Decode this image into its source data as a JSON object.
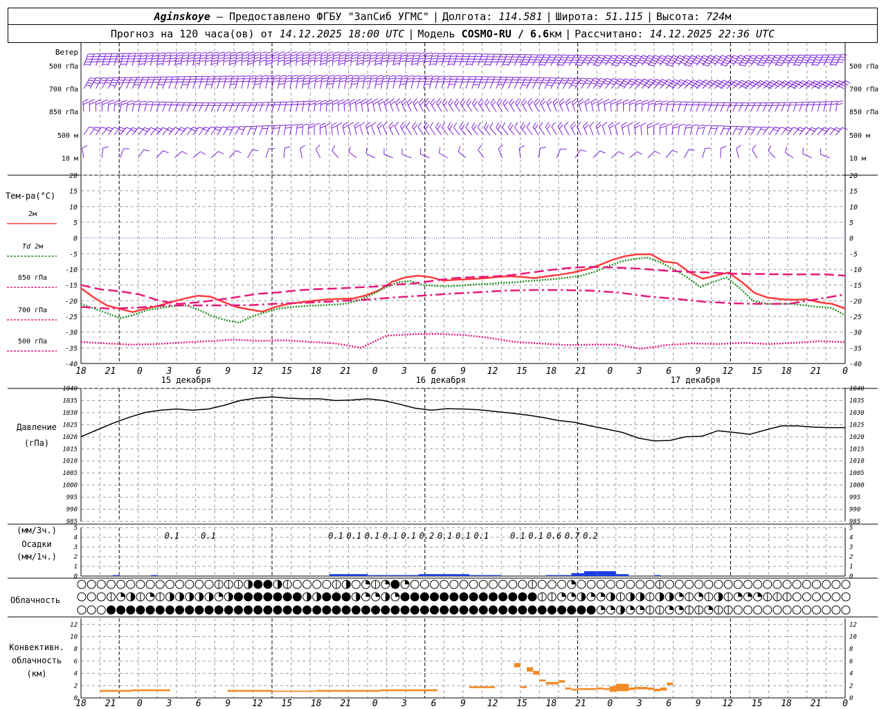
{
  "header": {
    "station": "Aginskoye",
    "provider": "– Предоставлено ФГБУ \"ЗапСиб УГМС\"",
    "lon_label": "Долгота:",
    "lon": "114.581",
    "lat_label": "Широта:",
    "lat": "51.115",
    "alt_label": "Высота:",
    "alt": "724",
    "alt_unit": "м",
    "forecast_label": "Прогноз на 120 часа(ов) от",
    "forecast_start": "14.12.2025 18:00 UTC",
    "model_label": "Модель",
    "model": "COSMO-RU / 6.6",
    "model_unit": "км",
    "calc_label": "Рассчитано:",
    "calc_time": "14.12.2025 22:36 UTC"
  },
  "chart_data": [
    {
      "type": "wind-barbs",
      "title": "Ветер",
      "levels": [
        "500 гПа",
        "700 гПа",
        "850 гПа",
        "500 м",
        "10 м"
      ],
      "colors": {
        "barb": "#7B1FD6"
      }
    },
    {
      "type": "line",
      "title": "Тем-ра(°C)",
      "ylim": [
        -40,
        20
      ],
      "yticks": [
        20,
        15,
        10,
        5,
        0,
        -5,
        -10,
        -15,
        -20,
        -25,
        -30,
        -35,
        -40
      ],
      "x_hours": [
        0,
        3,
        6,
        9,
        12,
        15,
        18,
        21,
        24,
        27,
        30,
        33,
        36,
        39,
        42,
        45,
        48,
        51,
        54,
        57,
        60,
        63,
        66,
        69,
        72,
        75,
        78,
        81,
        84,
        87,
        90,
        93,
        96,
        99,
        102,
        105,
        108,
        111,
        114,
        117,
        120,
        123,
        126,
        129,
        132,
        135,
        138,
        141,
        144,
        147,
        150,
        153,
        156,
        159,
        162,
        165,
        168,
        171,
        174,
        177,
        180,
        183,
        186,
        189,
        192,
        195,
        198,
        201,
        204,
        207,
        210,
        213,
        216,
        219,
        222,
        225,
        228,
        231,
        234,
        237,
        240,
        243,
        246,
        249,
        252,
        255,
        258,
        261,
        264,
        267,
        270,
        273,
        276,
        279,
        282,
        285,
        288,
        291,
        294,
        297,
        300,
        303,
        306,
        309,
        312,
        315,
        318,
        321,
        324,
        327,
        330,
        333,
        336,
        339,
        342,
        345,
        348,
        351,
        354,
        357,
        360,
        363,
        366,
        369,
        372,
        375,
        378
      ],
      "series": [
        {
          "name": "2м",
          "color": "#FF3B3B",
          "style": "solid",
          "values": [
            -16,
            -19,
            -21.5,
            -22.6,
            -23.6,
            -22.5,
            -21.6,
            -20.4,
            -19.3,
            -18.4,
            -18.7,
            -20.4,
            -22,
            -22.8,
            -23.5,
            -22,
            -21,
            -20.5,
            -20,
            -19.6,
            -19.4,
            -19.3,
            -18.3,
            -16.7,
            -14,
            -12.6,
            -12,
            -12.5,
            -13.6,
            -13.3,
            -13.1,
            -12.9,
            -12.5,
            -12.2,
            -12.4,
            -12.8,
            -12.2,
            -11.7,
            -11,
            -10,
            -8.7,
            -7,
            -5.8,
            -5.2,
            -5.2,
            -7.5,
            -8,
            -11,
            -13,
            -12,
            -11,
            -14,
            -17.5,
            -19,
            -19.5,
            -19.7,
            -19.5,
            -20.5,
            -21,
            -22.5
          ]
        },
        {
          "name": "Td 2м",
          "color": "#1E8C1E",
          "style": "dotted",
          "values": [
            -21,
            -22.5,
            -24,
            -25.6,
            -24.5,
            -23,
            -22.3,
            -21.7,
            -21.5,
            -23,
            -25,
            -26.2,
            -27,
            -25,
            -23.7,
            -22.5,
            -22,
            -21.7,
            -21.5,
            -21.3,
            -21,
            -20,
            -18.2,
            -16,
            -14.2,
            -13.7,
            -15,
            -15.3,
            -15.4,
            -15.1,
            -14.8,
            -14.6,
            -14.3,
            -14.1,
            -13.7,
            -13.4,
            -13.1,
            -12.6,
            -12,
            -10.8,
            -9,
            -7.5,
            -6.7,
            -6.3,
            -7.8,
            -10,
            -12.5,
            -15.6,
            -14,
            -12.6,
            -16,
            -20,
            -21,
            -21,
            -21,
            -21.5,
            -22,
            -22.3,
            -24.7
          ]
        },
        {
          "name": "850 гПа",
          "color": "#E6197D",
          "style": "longdash",
          "values": [
            -15,
            -16.4,
            -17,
            -18,
            -20,
            -21,
            -20.5,
            -19.7,
            -18.8,
            -17.8,
            -17.4,
            -16.7,
            -16.3,
            -16.1,
            -15.8,
            -15.5,
            -14.9,
            -14.5,
            -13.6,
            -12.8,
            -12.5,
            -12.3,
            -11.8,
            -11,
            -10.2,
            -9.5,
            -9.2,
            -9.4,
            -9.6,
            -10,
            -10.5,
            -10.8,
            -11,
            -11.3,
            -11.5,
            -11.5,
            -11.6,
            -11.6,
            -11.6,
            -12
          ]
        },
        {
          "name": "700 гПа",
          "color": "#E6197D",
          "style": "dashdot",
          "values": [
            -22,
            -22.5,
            -22.2,
            -21.5,
            -21.5,
            -21.5,
            -21.4,
            -20.9,
            -20.6,
            -20.2,
            -19.7,
            -19,
            -18.4,
            -17.8,
            -17.3,
            -16.8,
            -16.6,
            -16.6,
            -16.8,
            -17.4,
            -18.6,
            -19.4,
            -20.3,
            -20.8,
            -21,
            -21,
            -19.5,
            -18
          ]
        },
        {
          "name": "500 гПа",
          "color": "#E6197D",
          "style": "dotted",
          "values": [
            -33.1,
            -33.6,
            -34,
            -33.8,
            -33.3,
            -32.9,
            -32.4,
            -32.8,
            -32.6,
            -33.1,
            -33.6,
            -35,
            -31.1,
            -30.7,
            -30.6,
            -30.9,
            -31.8,
            -33.1,
            -33.6,
            -34.1,
            -34,
            -34,
            -35.3,
            -34.1,
            -33.6,
            -33.8,
            -33.4,
            -33.8,
            -33.4,
            -32.9,
            -33.2
          ]
        }
      ]
    },
    {
      "type": "line",
      "title": "Давление",
      "ylabel": "(гПа)",
      "ylim": [
        985,
        1040
      ],
      "yticks": [
        1040,
        1035,
        1030,
        1025,
        1020,
        1015,
        1010,
        1005,
        1000,
        995,
        990,
        985
      ],
      "series": [
        {
          "name": "Давление",
          "color": "#000000",
          "values": [
            1020,
            1022.8,
            1025.6,
            1028,
            1030,
            1031,
            1031.5,
            1031,
            1031.5,
            1033,
            1035,
            1036,
            1036.5,
            1036,
            1035.7,
            1035.7,
            1035,
            1035.2,
            1035.7,
            1035,
            1033.5,
            1031.8,
            1031,
            1031.6,
            1031.5,
            1031.2,
            1030.5,
            1029.8,
            1029,
            1028,
            1026.7,
            1026,
            1024.5,
            1023.2,
            1021.8,
            1019.5,
            1018.3,
            1018.5,
            1020,
            1020.2,
            1022.5,
            1021.8,
            1021,
            1022.8,
            1024.5,
            1024.5,
            1024,
            1023.8,
            1023.8
          ]
        }
      ]
    },
    {
      "type": "bar",
      "title": "Осадки",
      "ylabel_top": "(мм/3ч.)",
      "ylabel_bottom": "(мм/1ч.)",
      "ylim": [
        0,
        5
      ],
      "yticks": [
        5,
        4,
        3,
        2,
        1,
        0
      ],
      "totals_3h": [
        {
          "hour": 15,
          "value": "0.1"
        },
        {
          "hour": 21,
          "value": "0.1"
        },
        {
          "hour": 42,
          "value": "0.1"
        },
        {
          "hour": 45,
          "value": "0.1"
        },
        {
          "hour": 48,
          "value": "0.1"
        },
        {
          "hour": 51,
          "value": "0.1"
        },
        {
          "hour": 54,
          "value": "0.1"
        },
        {
          "hour": 57,
          "value": "0.2"
        },
        {
          "hour": 60,
          "value": "0.1"
        },
        {
          "hour": 63,
          "value": "0.1"
        },
        {
          "hour": 66,
          "value": "0.1"
        },
        {
          "hour": 72,
          "value": "0.1"
        },
        {
          "hour": 75,
          "value": "0.1"
        },
        {
          "hour": 78,
          "value": "0.6"
        },
        {
          "hour": 81,
          "value": "0.7"
        },
        {
          "hour": 84,
          "value": "0.2"
        }
      ],
      "hourly": [
        {
          "h0": 5,
          "h1": 6,
          "value": 0.1
        },
        {
          "h0": 11,
          "h1": 12,
          "value": 0.1
        },
        {
          "h0": 39,
          "h1": 45,
          "value": 0.2
        },
        {
          "h0": 45,
          "h1": 53,
          "value": 0.1
        },
        {
          "h0": 53,
          "h1": 56,
          "value": 0.2
        },
        {
          "h0": 56,
          "h1": 61,
          "value": 0.2
        },
        {
          "h0": 61,
          "h1": 66,
          "value": 0.1
        },
        {
          "h0": 73,
          "h1": 77,
          "value": 0.1
        },
        {
          "h0": 77,
          "h1": 79,
          "value": 0.3
        },
        {
          "h0": 79,
          "h1": 81,
          "value": 0.5
        },
        {
          "h0": 81,
          "h1": 84,
          "value": 0.5
        },
        {
          "h0": 84,
          "h1": 86,
          "value": 0.2
        },
        {
          "h0": 90,
          "h1": 91,
          "value": 0.1
        }
      ],
      "colors": {
        "bar": "#1A3FE0"
      }
    },
    {
      "type": "table",
      "title": "Облачность",
      "rows": [
        "0000000000000000000000001111112344413310000000211300121123432101000000000000000000011000001200000000000000001100000000000000000000000000000000000",
        "0000112233212312333333333233344444444444413334444443122231244444444444444444444444444310123233123223123332123332111211233121232311111000000000000",
        "0000044444444444444444444444444444444444444444444444444444444444444444444444444444444444444444442212312321111222211112111100000000000000000000000"
      ]
    },
    {
      "type": "bar",
      "title": "Конвективн.",
      "ylabel": [
        "облачность",
        "(км)"
      ],
      "ylim": [
        0,
        13
      ],
      "yticks": [
        12,
        10,
        8,
        6,
        4,
        2,
        0
      ],
      "segments": [
        {
          "h0": 3,
          "h1": 5,
          "bottom": 1.0,
          "top": 1.3
        },
        {
          "h0": 5,
          "h1": 8,
          "bottom": 1.0,
          "top": 1.3
        },
        {
          "h0": 8,
          "h1": 11,
          "bottom": 1.1,
          "top": 1.4
        },
        {
          "h0": 11,
          "h1": 14,
          "bottom": 1.1,
          "top": 1.4
        },
        {
          "h0": 23,
          "h1": 30,
          "bottom": 1.0,
          "top": 1.3
        },
        {
          "h0": 30,
          "h1": 37,
          "bottom": 1.0,
          "top": 1.2
        },
        {
          "h0": 37,
          "h1": 40,
          "bottom": 1.0,
          "top": 1.3
        },
        {
          "h0": 40,
          "h1": 47,
          "bottom": 1.0,
          "top": 1.3
        },
        {
          "h0": 47,
          "h1": 53,
          "bottom": 1.1,
          "top": 1.4
        },
        {
          "h0": 53,
          "h1": 56,
          "bottom": 1.1,
          "top": 1.4
        },
        {
          "h0": 61,
          "h1": 64,
          "bottom": 1.6,
          "top": 1.9
        },
        {
          "h0": 64,
          "h1": 65,
          "bottom": 1.6,
          "top": 1.9
        },
        {
          "h0": 68,
          "h1": 69,
          "bottom": 5.0,
          "top": 5.7
        },
        {
          "h0": 69,
          "h1": 70,
          "bottom": 1.6,
          "top": 1.9
        },
        {
          "h0": 70,
          "h1": 71,
          "bottom": 4.3,
          "top": 5.0
        },
        {
          "h0": 71,
          "h1": 72,
          "bottom": 3.8,
          "top": 4.4
        },
        {
          "h0": 72,
          "h1": 73,
          "bottom": 2.7,
          "top": 3.0
        },
        {
          "h0": 73,
          "h1": 75,
          "bottom": 2.2,
          "top": 2.6
        },
        {
          "h0": 75,
          "h1": 76,
          "bottom": 2.5,
          "top": 2.9
        },
        {
          "h0": 76,
          "h1": 77,
          "bottom": 1.4,
          "top": 1.7
        },
        {
          "h0": 77,
          "h1": 78,
          "bottom": 1.2,
          "top": 1.5
        },
        {
          "h0": 78,
          "h1": 81,
          "bottom": 1.3,
          "top": 1.6
        },
        {
          "h0": 81,
          "h1": 82,
          "bottom": 1.4,
          "top": 1.7
        },
        {
          "h0": 82,
          "h1": 83,
          "bottom": 1.3,
          "top": 1.6
        },
        {
          "h0": 83,
          "h1": 84,
          "bottom": 1.0,
          "top": 1.9
        },
        {
          "h0": 84,
          "h1": 86,
          "bottom": 1.1,
          "top": 2.3
        },
        {
          "h0": 86,
          "h1": 87,
          "bottom": 1.3,
          "top": 1.7
        },
        {
          "h0": 87,
          "h1": 89,
          "bottom": 1.4,
          "top": 1.8
        },
        {
          "h0": 89,
          "h1": 90,
          "bottom": 1.3,
          "top": 1.7
        },
        {
          "h0": 90,
          "h1": 91,
          "bottom": 1.1,
          "top": 1.5
        },
        {
          "h0": 91,
          "h1": 92,
          "bottom": 1.2,
          "top": 1.7
        },
        {
          "h0": 92,
          "h1": 93,
          "bottom": 2.1,
          "top": 2.5
        }
      ],
      "colors": {
        "bar": "#F08A24"
      }
    }
  ],
  "time_axis": {
    "ticks": [
      "18",
      "21",
      "0",
      "3",
      "6",
      "9",
      "12",
      "15",
      "18",
      "21",
      "0",
      "3",
      "6",
      "9",
      "12",
      "15",
      "18",
      "21",
      "0",
      "3",
      "6",
      "9",
      "12",
      "15",
      "18",
      "21",
      "0"
    ],
    "days": [
      "15 декабря",
      "16 декабря",
      "17 декабря"
    ]
  },
  "colors": {
    "grid": "#9A9A9A",
    "zero_line": "#2A4BFF"
  }
}
